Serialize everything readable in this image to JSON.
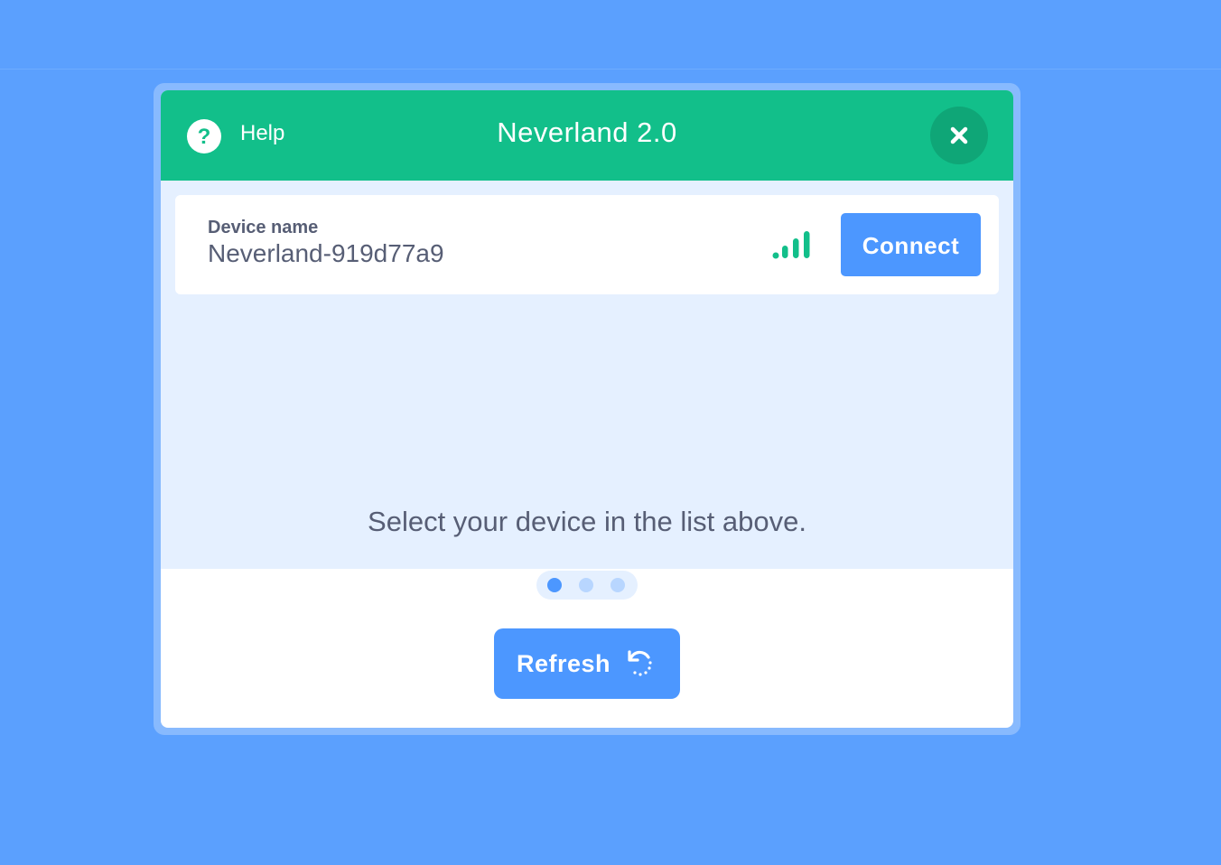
{
  "header": {
    "help_label": "Help",
    "title": "Neverland 2.0",
    "help_icon": "question-icon",
    "close_icon": "close-icon"
  },
  "device": {
    "name_label": "Device name",
    "name_value": "Neverland-919d77a9",
    "signal_icon": "signal-strength-icon",
    "signal_level": 4,
    "connect_label": "Connect"
  },
  "footer": {
    "instruction": "Select your device in the list above.",
    "step_count": 3,
    "active_step": 1,
    "refresh_label": "Refresh",
    "refresh_icon": "refresh-icon"
  },
  "colors": {
    "background": "#5ba0fe",
    "header": "#12bf8a",
    "accent": "#4c97ff",
    "list_background": "#e5f0ff",
    "text": "#575e75"
  }
}
